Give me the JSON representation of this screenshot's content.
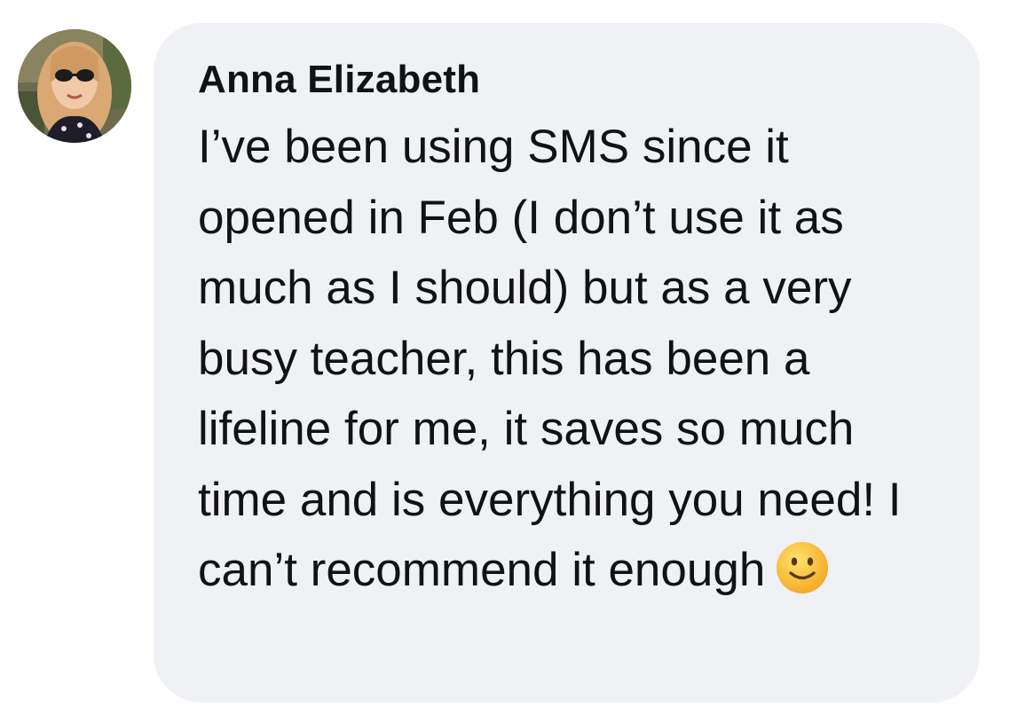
{
  "comment": {
    "author": "Anna Elizabeth",
    "text": "I’ve been using SMS since it opened in Feb (I don’t use it as much as I should) but as a very busy teacher, this has been a lifeline for me, it saves so much time and is everything you need! I can’t recommend it enough",
    "emoji": "slightly-smiling-face-emoji",
    "avatar": "profile-photo",
    "colors": {
      "bubble": "#f0f1f5",
      "text": "#111216",
      "emoji": "#f7b731"
    }
  }
}
